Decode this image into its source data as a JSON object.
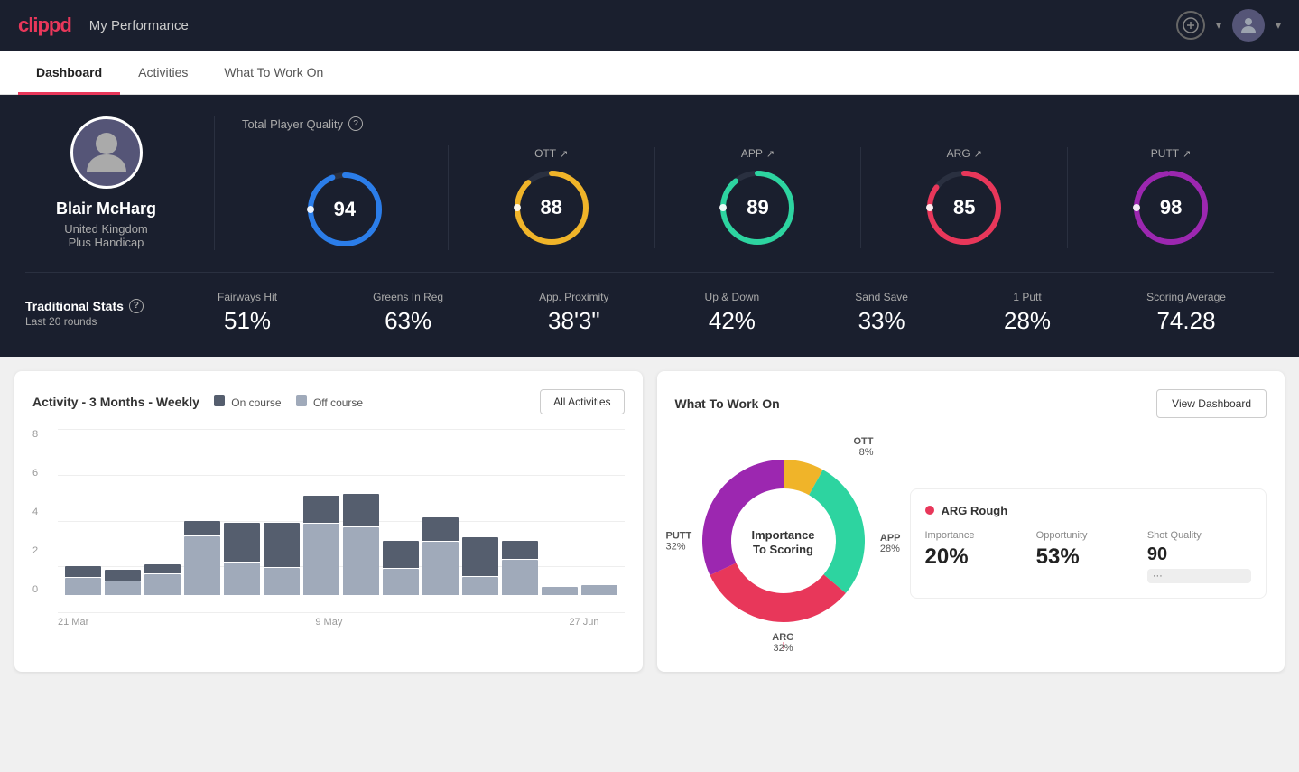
{
  "header": {
    "logo": "clippd",
    "title": "My Performance",
    "add_label": "+",
    "dropdown_label": "▾"
  },
  "nav": {
    "tabs": [
      {
        "id": "dashboard",
        "label": "Dashboard",
        "active": true
      },
      {
        "id": "activities",
        "label": "Activities",
        "active": false
      },
      {
        "id": "what-to-work-on",
        "label": "What To Work On",
        "active": false
      }
    ]
  },
  "player": {
    "name": "Blair McHarg",
    "country": "United Kingdom",
    "handicap": "Plus Handicap"
  },
  "quality": {
    "header": "Total Player Quality",
    "scores": [
      {
        "id": "total",
        "label": "",
        "value": "94",
        "color": "#2b7de9",
        "bg_color": "#1a2a4a",
        "pct": 94
      },
      {
        "id": "ott",
        "label": "OTT",
        "value": "88",
        "color": "#f0b429",
        "bg_color": "#1a2a1a",
        "pct": 88
      },
      {
        "id": "app",
        "label": "APP",
        "value": "89",
        "color": "#2dd4a0",
        "bg_color": "#1a2a2a",
        "pct": 89
      },
      {
        "id": "arg",
        "label": "ARG",
        "value": "85",
        "color": "#e8375a",
        "bg_color": "#2a1a2a",
        "pct": 85
      },
      {
        "id": "putt",
        "label": "PUTT",
        "value": "98",
        "color": "#9c27b0",
        "bg_color": "#1a1a2a",
        "pct": 98
      }
    ]
  },
  "traditional_stats": {
    "title": "Traditional Stats",
    "subtitle": "Last 20 rounds",
    "items": [
      {
        "name": "Fairways Hit",
        "value": "51%"
      },
      {
        "name": "Greens In Reg",
        "value": "63%"
      },
      {
        "name": "App. Proximity",
        "value": "38'3\""
      },
      {
        "name": "Up & Down",
        "value": "42%"
      },
      {
        "name": "Sand Save",
        "value": "33%"
      },
      {
        "name": "1 Putt",
        "value": "28%"
      },
      {
        "name": "Scoring Average",
        "value": "74.28"
      }
    ]
  },
  "activity_chart": {
    "title": "Activity - 3 Months - Weekly",
    "legend_on_course": "On course",
    "legend_off_course": "Off course",
    "btn_label": "All Activities",
    "on_course_color": "#555e6e",
    "off_course_color": "#a0aaba",
    "bars": [
      {
        "on": 0.6,
        "off": 1.0
      },
      {
        "on": 0.6,
        "off": 0.8
      },
      {
        "on": 0.5,
        "off": 1.2
      },
      {
        "on": 0.8,
        "off": 3.3
      },
      {
        "on": 2.2,
        "off": 1.8
      },
      {
        "on": 2.5,
        "off": 1.5
      },
      {
        "on": 1.5,
        "off": 4.0
      },
      {
        "on": 1.8,
        "off": 3.8
      },
      {
        "on": 1.5,
        "off": 1.5
      },
      {
        "on": 1.3,
        "off": 3.0
      },
      {
        "on": 2.2,
        "off": 1.0
      },
      {
        "on": 1.0,
        "off": 2.0
      },
      {
        "on": 0.0,
        "off": 0.5
      },
      {
        "on": 0.0,
        "off": 0.6
      }
    ],
    "x_labels": [
      "21 Mar",
      "9 May",
      "27 Jun"
    ],
    "y_labels": [
      "0",
      "2",
      "4",
      "6",
      "8"
    ],
    "max_val": 9
  },
  "what_to_work_on": {
    "title": "What To Work On",
    "btn_label": "View Dashboard",
    "center_text": "Importance\nTo Scoring",
    "segments": [
      {
        "label": "OTT",
        "pct": "8%",
        "color": "#f0b429",
        "startAngle": 0,
        "endAngle": 29
      },
      {
        "label": "APP",
        "pct": "28%",
        "color": "#2dd4a0",
        "startAngle": 29,
        "endAngle": 130
      },
      {
        "label": "ARG",
        "pct": "32%",
        "color": "#e8375a",
        "startAngle": 130,
        "endAngle": 245
      },
      {
        "label": "PUTT",
        "pct": "32%",
        "color": "#9c27b0",
        "startAngle": 245,
        "endAngle": 360
      }
    ],
    "detail": {
      "title": "ARG Rough",
      "dot_color": "#e8375a",
      "metrics": [
        {
          "name": "Importance",
          "value": "20%"
        },
        {
          "name": "Opportunity",
          "value": "53%"
        },
        {
          "name": "Shot Quality",
          "value": "90",
          "tag": true
        }
      ]
    }
  }
}
